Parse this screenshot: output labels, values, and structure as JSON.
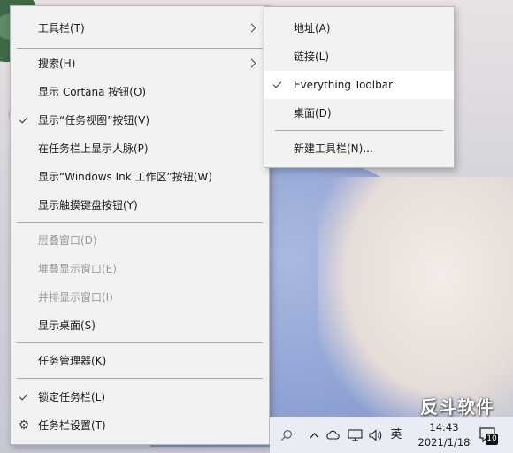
{
  "context_menu": {
    "items": [
      {
        "label": "工具栏(T)"
      },
      {
        "label": "搜索(H)"
      },
      {
        "label": "显示 Cortana 按钮(O)"
      },
      {
        "label": "显示“任务视图”按钮(V)"
      },
      {
        "label": "在任务栏上显示人脉(P)"
      },
      {
        "label": "显示“Windows Ink 工作区”按钮(W)"
      },
      {
        "label": "显示触摸键盘按钮(Y)"
      },
      {
        "label": "层叠窗口(D)"
      },
      {
        "label": "堆叠显示窗口(E)"
      },
      {
        "label": "并排显示窗口(I)"
      },
      {
        "label": "显示桌面(S)"
      },
      {
        "label": "任务管理器(K)"
      },
      {
        "label": "锁定任务栏(L)"
      },
      {
        "label": "任务栏设置(T)"
      }
    ]
  },
  "toolbar_submenu": {
    "items": [
      {
        "label": "地址(A)"
      },
      {
        "label": "链接(L)"
      },
      {
        "label": "Everything Toolbar"
      },
      {
        "label": "桌面(D)"
      },
      {
        "label": "新建工具栏(N)..."
      }
    ]
  },
  "taskbar": {
    "ime": "英",
    "time": "14:43",
    "date": "2021/1/18",
    "notification_count": "10",
    "icons": [
      "search-icon",
      "chevron-up-icon",
      "cloud-icon",
      "network-icon",
      "volume-icon",
      "notification-icon"
    ]
  },
  "watermark": "反斗软件",
  "colors": {
    "menu_bg": "#f2f2f2",
    "hover_bg": "#ffffff",
    "disabled_text": "#9a9a9a",
    "taskbar_bg": "#e9ecf4"
  }
}
